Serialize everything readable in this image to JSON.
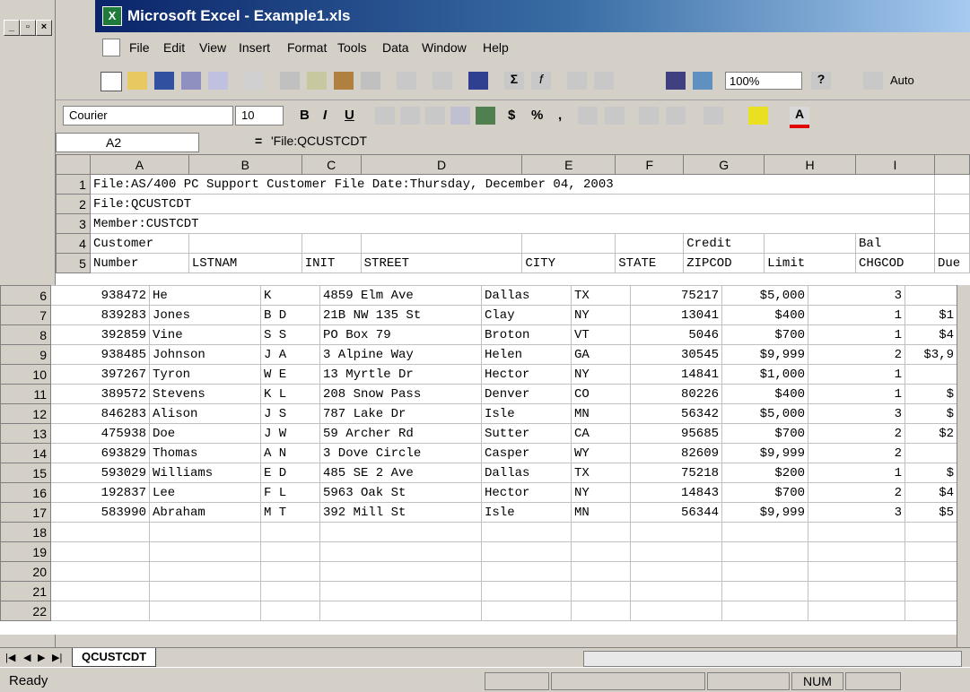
{
  "window": {
    "title": "Microsoft Excel - Example1.xls"
  },
  "menu": [
    "File",
    "Edit",
    "View",
    "Insert",
    "Format",
    "Tools",
    "Data",
    "Window",
    "Help"
  ],
  "toolbar": {
    "zoom": "100%",
    "auto_label": "Auto"
  },
  "format_toolbar": {
    "font": "Courier",
    "size": "10",
    "bold": "B",
    "italic": "I",
    "underline": "U",
    "currency": "$",
    "percent": "%",
    "comma": ","
  },
  "formula_bar": {
    "name_box": "A2",
    "equals": "=",
    "formula": "'File:QCUSTCDT"
  },
  "columns": [
    "A",
    "B",
    "C",
    "D",
    "E",
    "F",
    "G",
    "H",
    "I",
    ""
  ],
  "header_rows": [
    {
      "row": "1",
      "cells": [
        "File:AS/400 PC Support Customer File Date:Thursday, December 04, 2003",
        "",
        "",
        "",
        "",
        "",
        "",
        "",
        ""
      ]
    },
    {
      "row": "2",
      "cells": [
        "File:QCUSTCDT",
        "",
        "",
        "",
        "",
        "",
        "",
        "",
        ""
      ]
    },
    {
      "row": "3",
      "cells": [
        "Member:CUSTCDT",
        "",
        "",
        "",
        "",
        "",
        "",
        "",
        ""
      ]
    },
    {
      "row": "4",
      "cells": [
        "Customer",
        "",
        "",
        "",
        "",
        "",
        "Credit",
        "",
        "Bal"
      ]
    },
    {
      "row": "5",
      "cells": [
        "Number",
        "LSTNAM",
        "INIT",
        "STREET",
        "CITY",
        "STATE",
        "ZIPCOD",
        "Limit",
        "CHGCOD",
        "Due"
      ]
    }
  ],
  "data_rows": [
    {
      "row": "6",
      "number": "938472",
      "lstnam": "He",
      "init": "K",
      "street": "4859 Elm Ave",
      "city": "Dallas",
      "state": "TX",
      "zip": "75217",
      "limit": "$5,000",
      "chgcod": "3",
      "due": ""
    },
    {
      "row": "7",
      "number": "839283",
      "lstnam": "Jones",
      "init": "B D",
      "street": "21B NW 135 St",
      "city": "Clay",
      "state": "NY",
      "zip": "13041",
      "limit": "$400",
      "chgcod": "1",
      "due": "$1"
    },
    {
      "row": "8",
      "number": "392859",
      "lstnam": "Vine",
      "init": "S S",
      "street": "PO Box 79",
      "city": "Broton",
      "state": "VT",
      "zip": "5046",
      "limit": "$700",
      "chgcod": "1",
      "due": "$4"
    },
    {
      "row": "9",
      "number": "938485",
      "lstnam": "Johnson",
      "init": "J A",
      "street": "3 Alpine Way",
      "city": "Helen",
      "state": "GA",
      "zip": "30545",
      "limit": "$9,999",
      "chgcod": "2",
      "due": "$3,9"
    },
    {
      "row": "10",
      "number": "397267",
      "lstnam": "Tyron",
      "init": "W E",
      "street": "13 Myrtle Dr",
      "city": "Hector",
      "state": "NY",
      "zip": "14841",
      "limit": "$1,000",
      "chgcod": "1",
      "due": ""
    },
    {
      "row": "11",
      "number": "389572",
      "lstnam": "Stevens",
      "init": "K L",
      "street": "208 Snow Pass",
      "city": "Denver",
      "state": "CO",
      "zip": "80226",
      "limit": "$400",
      "chgcod": "1",
      "due": "$"
    },
    {
      "row": "12",
      "number": "846283",
      "lstnam": "Alison",
      "init": "J S",
      "street": "787 Lake Dr",
      "city": "Isle",
      "state": "MN",
      "zip": "56342",
      "limit": "$5,000",
      "chgcod": "3",
      "due": "$"
    },
    {
      "row": "13",
      "number": "475938",
      "lstnam": "Doe",
      "init": "J W",
      "street": "59 Archer Rd",
      "city": "Sutter",
      "state": "CA",
      "zip": "95685",
      "limit": "$700",
      "chgcod": "2",
      "due": "$2"
    },
    {
      "row": "14",
      "number": "693829",
      "lstnam": "Thomas",
      "init": "A N",
      "street": "3 Dove Circle",
      "city": "Casper",
      "state": "WY",
      "zip": "82609",
      "limit": "$9,999",
      "chgcod": "2",
      "due": ""
    },
    {
      "row": "15",
      "number": "593029",
      "lstnam": "Williams",
      "init": "E D",
      "street": "485 SE 2 Ave",
      "city": "Dallas",
      "state": "TX",
      "zip": "75218",
      "limit": "$200",
      "chgcod": "1",
      "due": "$"
    },
    {
      "row": "16",
      "number": "192837",
      "lstnam": "Lee",
      "init": "F L",
      "street": "5963 Oak St",
      "city": "Hector",
      "state": "NY",
      "zip": "14843",
      "limit": "$700",
      "chgcod": "2",
      "due": "$4"
    },
    {
      "row": "17",
      "number": "583990",
      "lstnam": "Abraham",
      "init": "M T",
      "street": "392 Mill St",
      "city": "Isle",
      "state": "MN",
      "zip": "56344",
      "limit": "$9,999",
      "chgcod": "3",
      "due": "$5"
    }
  ],
  "empty_rows": [
    "18",
    "19",
    "20",
    "21",
    "22"
  ],
  "sheet_tab": "QCUSTCDT",
  "status": {
    "text": "Ready",
    "num": "NUM"
  },
  "colors": {
    "title_start": "#0a246a",
    "title_end": "#a6caf0",
    "chrome": "#d4d0c8"
  }
}
